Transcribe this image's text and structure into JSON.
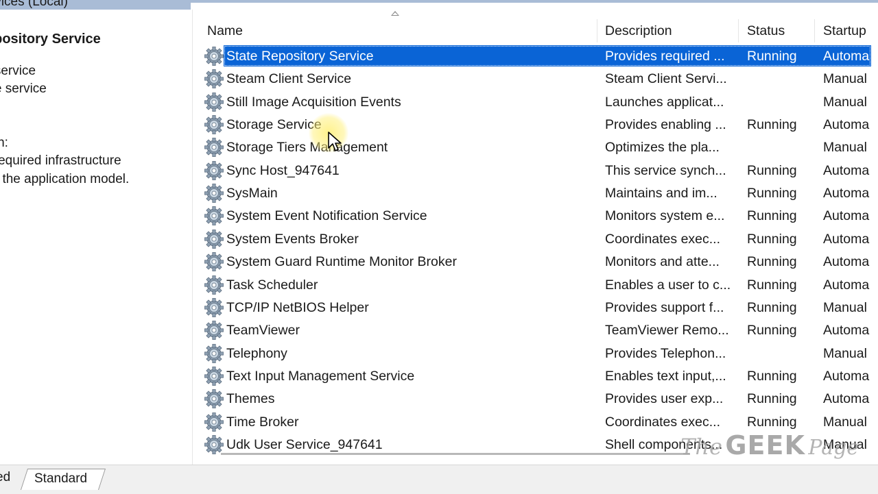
{
  "window": {
    "title_fragment": "rvices (Local)"
  },
  "left_pane": {
    "service_name": "epository Service",
    "lines": [
      "e service",
      "the service",
      "tion:",
      "s required infrastructure",
      "for the application model."
    ]
  },
  "columns": {
    "name": "Name",
    "description": "Description",
    "status": "Status",
    "startup": "Startup"
  },
  "rows": [
    {
      "name": "State Repository Service",
      "description": "Provides required ...",
      "status": "Running",
      "startup": "Automa"
    },
    {
      "name": "Steam Client Service",
      "description": "Steam Client Servi...",
      "status": "",
      "startup": "Manual"
    },
    {
      "name": "Still Image Acquisition Events",
      "description": "Launches applicat...",
      "status": "",
      "startup": "Manual"
    },
    {
      "name": "Storage Service",
      "description": "Provides enabling ...",
      "status": "Running",
      "startup": "Automa"
    },
    {
      "name": "Storage Tiers Management",
      "description": "Optimizes the pla...",
      "status": "",
      "startup": "Manual"
    },
    {
      "name": "Sync Host_947641",
      "description": "This service synch...",
      "status": "Running",
      "startup": "Automa"
    },
    {
      "name": "SysMain",
      "description": "Maintains and im...",
      "status": "Running",
      "startup": "Automa"
    },
    {
      "name": "System Event Notification Service",
      "description": "Monitors system e...",
      "status": "Running",
      "startup": "Automa"
    },
    {
      "name": "System Events Broker",
      "description": "Coordinates exec...",
      "status": "Running",
      "startup": "Automa"
    },
    {
      "name": "System Guard Runtime Monitor Broker",
      "description": "Monitors and atte...",
      "status": "Running",
      "startup": "Automa"
    },
    {
      "name": "Task Scheduler",
      "description": "Enables a user to c...",
      "status": "Running",
      "startup": "Automa"
    },
    {
      "name": "TCP/IP NetBIOS Helper",
      "description": "Provides support f...",
      "status": "Running",
      "startup": "Manual"
    },
    {
      "name": "TeamViewer",
      "description": "TeamViewer Remo...",
      "status": "Running",
      "startup": "Automa"
    },
    {
      "name": "Telephony",
      "description": "Provides Telephon...",
      "status": "",
      "startup": "Manual"
    },
    {
      "name": "Text Input Management Service",
      "description": "Enables text input,...",
      "status": "Running",
      "startup": "Automa"
    },
    {
      "name": "Themes",
      "description": "Provides user exp...",
      "status": "Running",
      "startup": "Automa"
    },
    {
      "name": "Time Broker",
      "description": "Coordinates exec...",
      "status": "Running",
      "startup": "Manual"
    },
    {
      "name": "Udk User Service_947641",
      "description": "Shell components...",
      "status": "",
      "startup": "Manual"
    }
  ],
  "selected_row": 0,
  "icon": "gear-icon",
  "tabs": {
    "extended_fragment": "ed",
    "standard": "Standard"
  },
  "watermark": {
    "the": "The",
    "geek": "GEEK",
    "page": "Page"
  },
  "colors": {
    "selection": "#0a64d6",
    "title_band": "#a9bcd6"
  }
}
